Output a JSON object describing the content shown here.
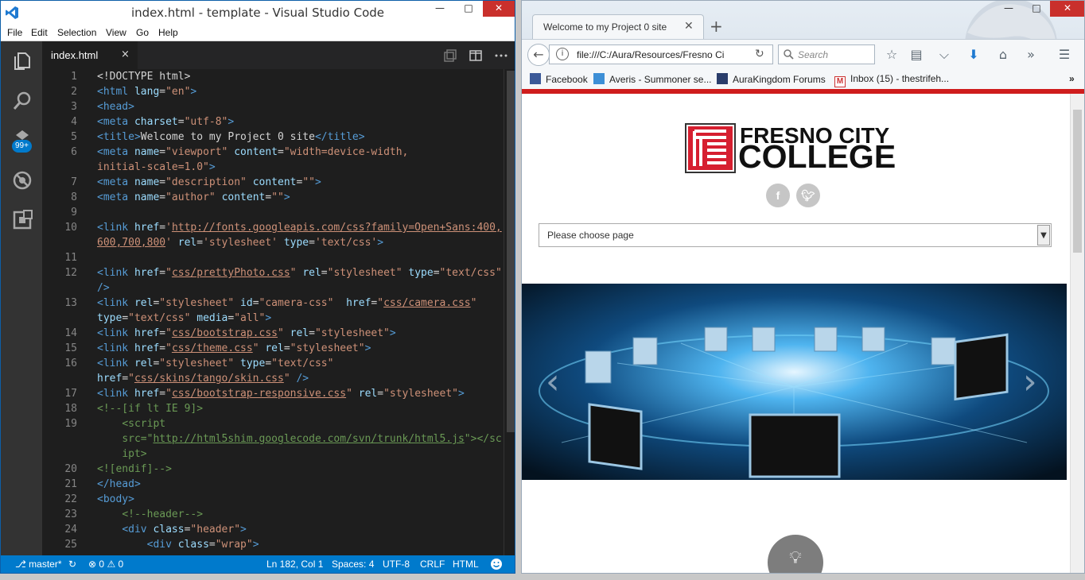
{
  "vscode": {
    "title": "index.html - template - Visual Studio Code",
    "menu": [
      "File",
      "Edit",
      "Selection",
      "View",
      "Go",
      "Help"
    ],
    "badge": "99+",
    "tab_label": "index.html",
    "tab_close": "×",
    "code_lines": [
      {
        "n": "1",
        "html": "<span class='w'>&lt;!DOCTYPE html&gt;</span>"
      },
      {
        "n": "2",
        "html": "<span class='t'>&lt;html</span> <span class='a'>lang</span>=<span class='s'>\"en\"</span><span class='t'>&gt;</span>"
      },
      {
        "n": "3",
        "html": "<span class='t'>&lt;head&gt;</span>"
      },
      {
        "n": "4",
        "html": "<span class='t'>&lt;meta</span> <span class='a'>charset</span>=<span class='s'>\"utf-8\"</span><span class='t'>&gt;</span>"
      },
      {
        "n": "5",
        "html": "<span class='t'>&lt;title&gt;</span><span class='w'>Welcome to my Project 0 site</span><span class='t'>&lt;/title&gt;</span>"
      },
      {
        "n": "6",
        "html": "<span class='t'>&lt;meta</span> <span class='a'>name</span>=<span class='s'>\"viewport\"</span> <span class='a'>content</span>=<span class='s'>\"width=device-width,</span>"
      },
      {
        "n": "",
        "html": "<span class='s'>initial-scale=1.0\"</span><span class='t'>&gt;</span>"
      },
      {
        "n": "7",
        "html": "<span class='t'>&lt;meta</span> <span class='a'>name</span>=<span class='s'>\"description\"</span> <span class='a'>content</span>=<span class='s'>\"\"</span><span class='t'>&gt;</span>"
      },
      {
        "n": "8",
        "html": "<span class='t'>&lt;meta</span> <span class='a'>name</span>=<span class='s'>\"author\"</span> <span class='a'>content</span>=<span class='s'>\"\"</span><span class='t'>&gt;</span>"
      },
      {
        "n": "9",
        "html": ""
      },
      {
        "n": "10",
        "html": "<span class='t'>&lt;link</span> <span class='a'>href</span>=<span class='s'>'<span class='u'>http://fonts.googleapis.com/css?family=Open+Sans:400,</span></span>"
      },
      {
        "n": "",
        "html": "<span class='s'><span class='u'>600,700,800</span>'</span> <span class='a'>rel</span>=<span class='s'>'stylesheet'</span> <span class='a'>type</span>=<span class='s'>'text/css'</span><span class='t'>&gt;</span>"
      },
      {
        "n": "11",
        "html": ""
      },
      {
        "n": "12",
        "html": "<span class='t'>&lt;link</span> <span class='a'>href</span>=<span class='s'>\"<span class='u'>css/prettyPhoto.css</span>\"</span> <span class='a'>rel</span>=<span class='s'>\"stylesheet\"</span> <span class='a'>type</span>=<span class='s'>\"text/css\"</span>"
      },
      {
        "n": "",
        "html": "<span class='t'>/&gt;</span>"
      },
      {
        "n": "13",
        "html": "<span class='t'>&lt;link</span> <span class='a'>rel</span>=<span class='s'>\"stylesheet\"</span> <span class='a'>id</span>=<span class='s'>\"camera-css\"</span>  <span class='a'>href</span>=<span class='s'>\"<span class='u'>css/camera.css</span>\"</span>"
      },
      {
        "n": "",
        "html": "<span class='a'>type</span>=<span class='s'>\"text/css\"</span> <span class='a'>media</span>=<span class='s'>\"all\"</span><span class='t'>&gt;</span>"
      },
      {
        "n": "14",
        "html": "<span class='t'>&lt;link</span> <span class='a'>href</span>=<span class='s'>\"<span class='u'>css/bootstrap.css</span>\"</span> <span class='a'>rel</span>=<span class='s'>\"stylesheet\"</span><span class='t'>&gt;</span>"
      },
      {
        "n": "15",
        "html": "<span class='t'>&lt;link</span> <span class='a'>href</span>=<span class='s'>\"<span class='u'>css/theme.css</span>\"</span> <span class='a'>rel</span>=<span class='s'>\"stylesheet\"</span><span class='t'>&gt;</span>"
      },
      {
        "n": "16",
        "html": "<span class='t'>&lt;link</span> <span class='a'>rel</span>=<span class='s'>\"stylesheet\"</span> <span class='a'>type</span>=<span class='s'>\"text/css\"</span>"
      },
      {
        "n": "",
        "html": "<span class='a'>href</span>=<span class='s'>\"<span class='u'>css/skins/tango/skin.css</span>\"</span> <span class='t'>/&gt;</span>"
      },
      {
        "n": "17",
        "html": "<span class='t'>&lt;link</span> <span class='a'>href</span>=<span class='s'>\"<span class='u'>css/bootstrap-responsive.css</span>\"</span> <span class='a'>rel</span>=<span class='s'>\"stylesheet\"</span><span class='t'>&gt;</span>"
      },
      {
        "n": "18",
        "html": "<span class='c'>&lt;!--[if lt IE 9]&gt;</span>"
      },
      {
        "n": "19",
        "html": "    <span class='c'>&lt;script</span>"
      },
      {
        "n": "",
        "html": "    <span class='c'>src=\"<span class='u'>http://html5shim.googlecode.com/svn/trunk/html5.js</span>\"&gt;&lt;/scr</span>"
      },
      {
        "n": "",
        "html": "    <span class='c'>ipt&gt;</span>"
      },
      {
        "n": "20",
        "html": "<span class='c'>&lt;![endif]--&gt;</span>"
      },
      {
        "n": "21",
        "html": "<span class='t'>&lt;/head&gt;</span>"
      },
      {
        "n": "22",
        "html": "<span class='t'>&lt;body&gt;</span>"
      },
      {
        "n": "23",
        "html": "    <span class='c'>&lt;!--header--&gt;</span>"
      },
      {
        "n": "24",
        "html": "    <span class='t'>&lt;div</span> <span class='a'>class</span>=<span class='s'>\"header\"</span><span class='t'>&gt;</span>"
      },
      {
        "n": "25",
        "html": "        <span class='t'>&lt;div</span> <span class='a'>class</span>=<span class='s'>\"wrap\"</span><span class='t'>&gt;</span>"
      }
    ],
    "status": {
      "branch": "master*",
      "errors": "0",
      "warnings": "0",
      "position": "Ln 182, Col 1",
      "spaces": "Spaces: 4",
      "encoding": "UTF-8",
      "eol": "CRLF",
      "language": "HTML"
    }
  },
  "firefox": {
    "tab_title": "Welcome to my Project 0 site",
    "url": "file:///C:/Aura/Resources/Fresno Ci",
    "search_placeholder": "Search",
    "bookmarks": [
      "Facebook",
      "Averis - Summoner se...",
      "AuraKingdom Forums",
      "Inbox (15) - thestrifeh..."
    ],
    "page": {
      "logo_line1": "FRESNO CITY",
      "logo_line2": "COLLEGE",
      "select_value": "Please choose page"
    }
  },
  "colors": {
    "vscode_accent": "#007acc",
    "fresno_red": "#cf1d1d"
  }
}
